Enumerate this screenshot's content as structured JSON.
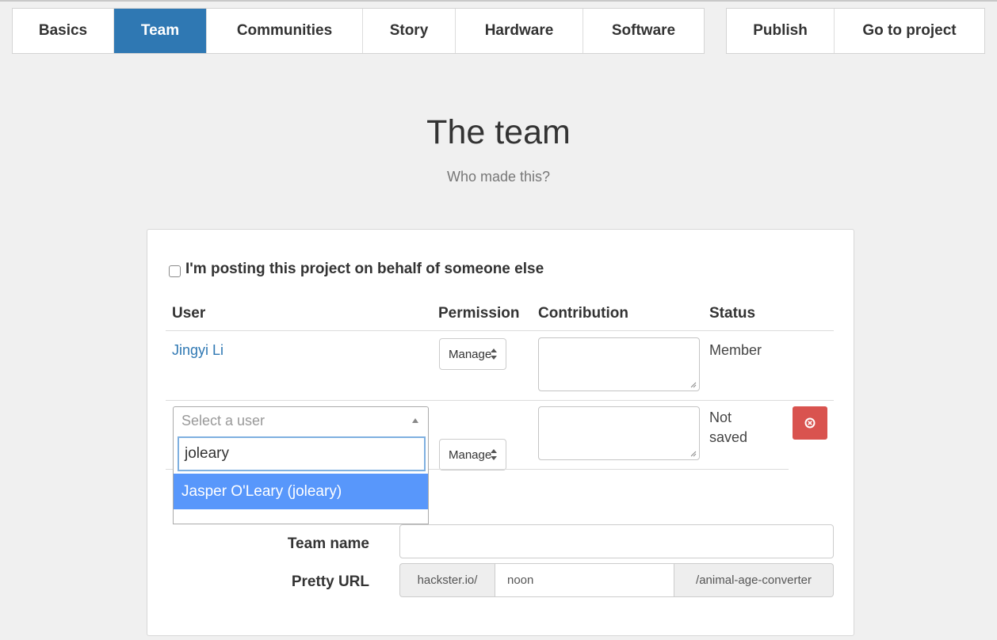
{
  "tabs_left": [
    {
      "label": "Basics",
      "width": 128,
      "active": false
    },
    {
      "label": "Team",
      "width": 117,
      "active": true
    },
    {
      "label": "Communities",
      "width": 197,
      "active": false
    },
    {
      "label": "Story",
      "width": 117,
      "active": false
    },
    {
      "label": "Hardware",
      "width": 161,
      "active": false
    },
    {
      "label": "Software",
      "width": 152,
      "active": false
    }
  ],
  "tabs_right": [
    {
      "label": "Publish",
      "width": 136,
      "active": false
    },
    {
      "label": "Go to project",
      "width": 189,
      "active": false
    }
  ],
  "header": {
    "title": "The team",
    "subtitle": "Who made this?"
  },
  "behalf": {
    "label": "I'm posting this project on behalf of someone else",
    "checked": false
  },
  "columns": {
    "user": "User",
    "permission": "Permission",
    "contribution": "Contribution",
    "status": "Status"
  },
  "rows": [
    {
      "user": "Jingyi Li",
      "permission": "Manage",
      "contribution": "",
      "status": "Member"
    },
    {
      "user_placeholder": "Select a user",
      "permission": "Manage",
      "contribution": "",
      "status_line1": "Not",
      "status_line2": "saved"
    }
  ],
  "user_search": {
    "query": "joleary",
    "option": "Jasper O'Leary (joleary)"
  },
  "team_name": {
    "label": "Team name",
    "value": ""
  },
  "pretty_url": {
    "label": "Pretty URL",
    "prefix": "hackster.io/",
    "value": "noon",
    "suffix": "/animal-age-converter"
  },
  "colors": {
    "active_tab": "#2f78b3",
    "link": "#2f78b3",
    "delete": "#d9534f",
    "highlight": "#5897fb"
  }
}
